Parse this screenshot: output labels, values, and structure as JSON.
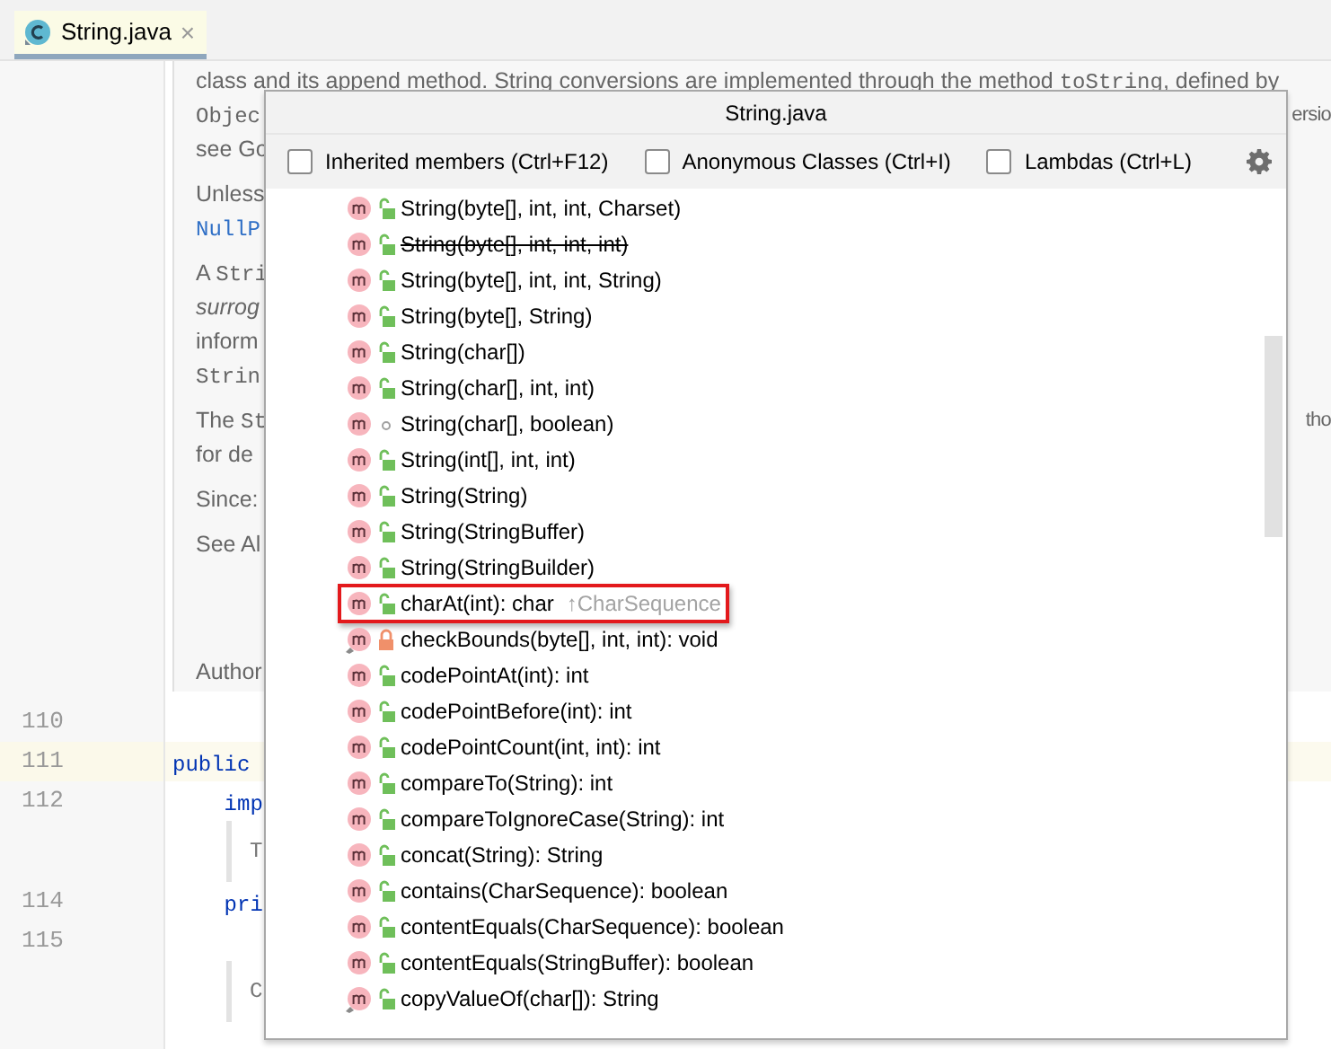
{
  "tab": {
    "title": "String.java",
    "close": "×",
    "selected": true
  },
  "doc": {
    "paragraphs": [
      {
        "lines": [
          {
            "segments": [
              {
                "text": "class and its append method. String conversions are implemented through the method ",
                "kind": "plain"
              },
              {
                "text": "toString",
                "kind": "mono"
              },
              {
                "text": ", defined by",
                "kind": "plain"
              }
            ]
          },
          {
            "segments": [
              {
                "text": "Objec",
                "kind": "mono"
              }
            ],
            "right": "ersio"
          },
          {
            "segments": [
              {
                "text": "see Go",
                "kind": "plain"
              }
            ]
          }
        ]
      },
      {
        "lines": [
          {
            "segments": [
              {
                "text": "Unless",
                "kind": "plain"
              }
            ]
          },
          {
            "segments": [
              {
                "text": "NullP",
                "kind": "link"
              }
            ]
          }
        ]
      },
      {
        "lines": [
          {
            "segments": [
              {
                "text": "A ",
                "kind": "plain"
              },
              {
                "text": "Stri",
                "kind": "mono"
              }
            ]
          },
          {
            "segments": [
              {
                "text": "surrog",
                "kind": "italic"
              }
            ]
          },
          {
            "segments": [
              {
                "text": "inform",
                "kind": "plain"
              }
            ]
          },
          {
            "segments": [
              {
                "text": "Strin",
                "kind": "mono"
              }
            ]
          }
        ]
      },
      {
        "lines": [
          {
            "segments": [
              {
                "text": "The ",
                "kind": "plain"
              },
              {
                "text": "St",
                "kind": "mono"
              }
            ],
            "right": "tho"
          },
          {
            "segments": [
              {
                "text": "for de",
                "kind": "plain"
              }
            ]
          }
        ]
      },
      {
        "lines": [
          {
            "segments": [
              {
                "text": "Since:",
                "kind": "plain"
              }
            ]
          }
        ]
      },
      {
        "lines": [
          {
            "segments": [
              {
                "text": "See Al",
                "kind": "plain"
              }
            ]
          }
        ]
      }
    ],
    "footer": "Author"
  },
  "code_rows": [
    {
      "kind": "code",
      "number": "110",
      "text": "",
      "current": false
    },
    {
      "kind": "code",
      "number": "111",
      "text": "public",
      "current": true
    },
    {
      "kind": "code",
      "number": "112",
      "text": "    imp",
      "current": false
    },
    {
      "kind": "doc",
      "text": "T"
    },
    {
      "kind": "code",
      "number": "114",
      "text": "    pri",
      "current": false
    },
    {
      "kind": "code",
      "number": "115",
      "text": "",
      "current": false
    },
    {
      "kind": "doc",
      "text": "C"
    }
  ],
  "popup": {
    "title": "String.java",
    "filters": [
      {
        "label": "Inherited members (Ctrl+F12)",
        "checked": false
      },
      {
        "label": "Anonymous Classes (Ctrl+I)",
        "checked": false
      },
      {
        "label": "Lambdas (Ctrl+L)",
        "checked": false
      }
    ],
    "members": [
      {
        "name": "String(byte[], int, int, Charset)",
        "kind": "public",
        "static": false,
        "deprecated": false,
        "highlighted": false
      },
      {
        "name": "String(byte[], int, int, int)",
        "kind": "public",
        "static": false,
        "deprecated": true,
        "highlighted": false
      },
      {
        "name": "String(byte[], int, int, String)",
        "kind": "public",
        "static": false,
        "deprecated": false,
        "highlighted": false
      },
      {
        "name": "String(byte[], String)",
        "kind": "public",
        "static": false,
        "deprecated": false,
        "highlighted": false
      },
      {
        "name": "String(char[])",
        "kind": "public",
        "static": false,
        "deprecated": false,
        "highlighted": false
      },
      {
        "name": "String(char[], int, int)",
        "kind": "public",
        "static": false,
        "deprecated": false,
        "highlighted": false
      },
      {
        "name": "String(char[], boolean)",
        "kind": "package",
        "static": false,
        "deprecated": false,
        "highlighted": false
      },
      {
        "name": "String(int[], int, int)",
        "kind": "public",
        "static": false,
        "deprecated": false,
        "highlighted": false
      },
      {
        "name": "String(String)",
        "kind": "public",
        "static": false,
        "deprecated": false,
        "highlighted": false
      },
      {
        "name": "String(StringBuffer)",
        "kind": "public",
        "static": false,
        "deprecated": false,
        "highlighted": false
      },
      {
        "name": "String(StringBuilder)",
        "kind": "public",
        "static": false,
        "deprecated": false,
        "highlighted": false
      },
      {
        "name": "charAt(int): char",
        "kind": "public",
        "static": false,
        "deprecated": false,
        "highlighted": true,
        "inherited_from": "↑CharSequence"
      },
      {
        "name": "checkBounds(byte[], int, int): void",
        "kind": "private",
        "static": true,
        "deprecated": false,
        "highlighted": false
      },
      {
        "name": "codePointAt(int): int",
        "kind": "public",
        "static": false,
        "deprecated": false,
        "highlighted": false
      },
      {
        "name": "codePointBefore(int): int",
        "kind": "public",
        "static": false,
        "deprecated": false,
        "highlighted": false
      },
      {
        "name": "codePointCount(int, int): int",
        "kind": "public",
        "static": false,
        "deprecated": false,
        "highlighted": false
      },
      {
        "name": "compareTo(String): int",
        "kind": "public",
        "static": false,
        "deprecated": false,
        "highlighted": false
      },
      {
        "name": "compareToIgnoreCase(String): int",
        "kind": "public",
        "static": false,
        "deprecated": false,
        "highlighted": false
      },
      {
        "name": "concat(String): String",
        "kind": "public",
        "static": false,
        "deprecated": false,
        "highlighted": false
      },
      {
        "name": "contains(CharSequence): boolean",
        "kind": "public",
        "static": false,
        "deprecated": false,
        "highlighted": false
      },
      {
        "name": "contentEquals(CharSequence): boolean",
        "kind": "public",
        "static": false,
        "deprecated": false,
        "highlighted": false
      },
      {
        "name": "contentEquals(StringBuffer): boolean",
        "kind": "public",
        "static": false,
        "deprecated": false,
        "highlighted": false
      },
      {
        "name": "copyValueOf(char[]): String",
        "kind": "public",
        "static": true,
        "deprecated": false,
        "highlighted": false
      }
    ]
  }
}
